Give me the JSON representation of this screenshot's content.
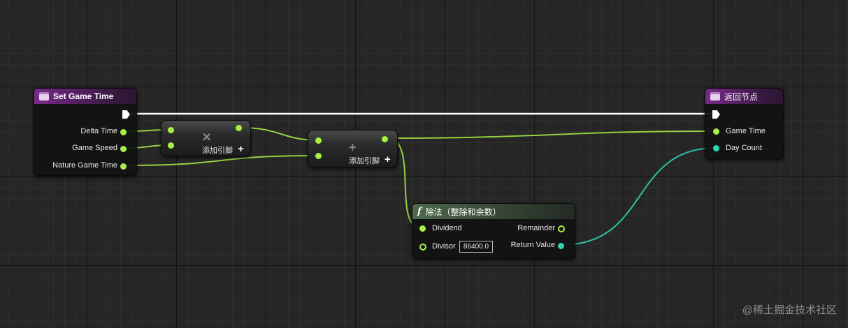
{
  "set_game_time": {
    "title": "Set Game Time",
    "inputs": [
      "Delta Time",
      "Game Speed",
      "Nature Game Time"
    ]
  },
  "multiply_node": {
    "add_pin_label": "添加引脚",
    "op_icon": "multiply-icon"
  },
  "add_node": {
    "add_pin_label": "添加引脚",
    "op_icon": "plus-icon"
  },
  "divide_node": {
    "title": "除法（整除和余数）",
    "func_icon": "f",
    "dividend_label": "Dividend",
    "divisor_label": "Divisor",
    "divisor_value": "86400.0",
    "remainder_label": "Remainder",
    "return_label": "Return Value"
  },
  "return_node": {
    "title": "返回节点",
    "outputs": [
      "Game Time",
      "Day Count"
    ]
  },
  "watermark": "@稀土掘金技术社区",
  "colors": {
    "float_pin": "#a7f045",
    "int_pin": "#2fd3b0",
    "exec_wire": "#ffffff",
    "event_header": "#7a2a8a"
  }
}
